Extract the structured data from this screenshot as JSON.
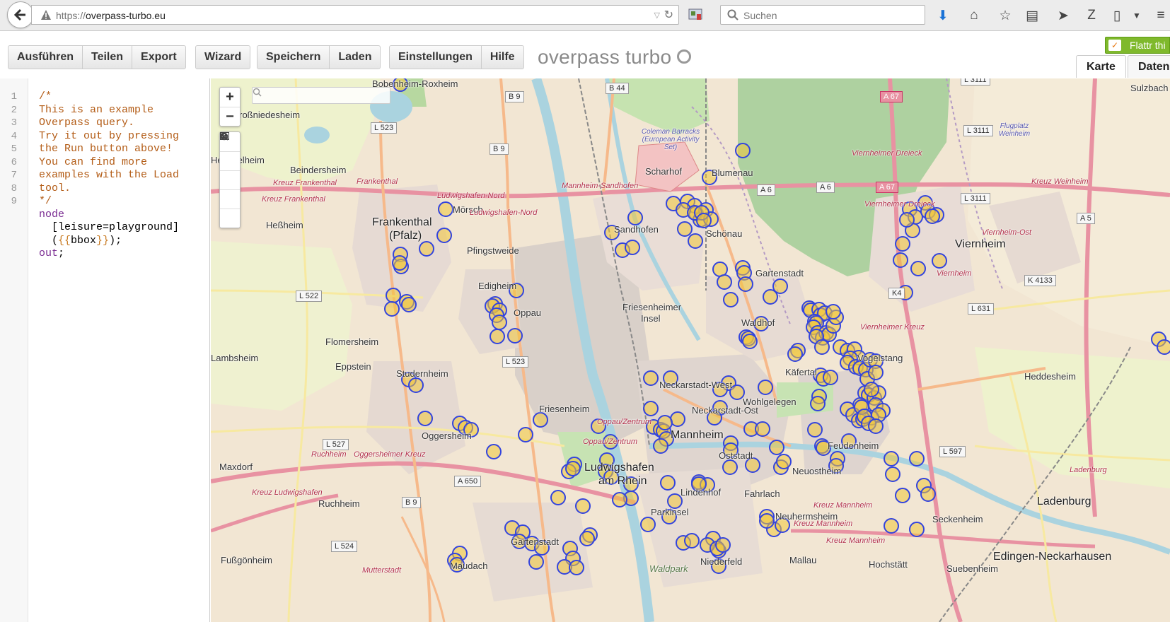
{
  "browser": {
    "url_prefix": "https://",
    "url_host": "overpass-turbo.eu",
    "search_placeholder": "Suchen"
  },
  "toolbar": {
    "buttons_group1": [
      "Ausführen",
      "Teilen",
      "Export"
    ],
    "buttons_group2": [
      "Wizard"
    ],
    "buttons_group3": [
      "Speichern",
      "Laden"
    ],
    "buttons_group4": [
      "Einstellungen",
      "Hilfe"
    ],
    "title": "overpass turbo",
    "flattr_label": "Flattr thi",
    "tab_map": "Karte",
    "tab_data": "Daten"
  },
  "editor": {
    "lines": [
      {
        "n": "1",
        "text": "/*"
      },
      {
        "n": "2",
        "text": "This is an example"
      },
      {
        "n": "3",
        "text": "Overpass query."
      },
      {
        "n": "4",
        "text": "Try it out by pressing"
      },
      {
        "n": "5",
        "text": "the Run button above!"
      },
      {
        "n": "6",
        "text": "You can find more"
      },
      {
        "n": "7",
        "text": "examples with the Load"
      },
      {
        "n": "8",
        "text": "tool."
      },
      {
        "n": "9",
        "text": "*/"
      },
      {
        "n": "",
        "text": "node"
      },
      {
        "n": "",
        "text": "  [leisure=playground]"
      },
      {
        "n": "",
        "text": "  ({{bbox}});"
      },
      {
        "n": "",
        "text": "out;"
      }
    ]
  },
  "map": {
    "controls": {
      "zoom_in": "+",
      "zoom_out": "−"
    },
    "labels": {
      "bobenheim": "Bobenheim-Roxheim",
      "grossniedesheim": "Großniedesheim",
      "heuchelheim": "Heuchelheim",
      "beindersheim": "Beindersheim",
      "hessheim": "Heßheim",
      "frankenthal": "Frankenthal",
      "pfalz": "(Pfalz)",
      "morsch": "Mörsch",
      "pfingstweide": "Pfingstweide",
      "edigheim": "Edigheim",
      "oppau": "Oppau",
      "flomersheim": "Flomersheim",
      "eppstein": "Eppstein",
      "lambsheim": "Lambsheim",
      "studernheim": "Studernheim",
      "oggersheim": "Oggersheim",
      "maxdorf": "Maxdorf",
      "ruchheim": "Ruchheim",
      "fussgonheim": "Fußgönheim",
      "maudach": "Maudach",
      "gartenstadt_lu": "Gartenstadt",
      "friesenheim": "Friesenheim",
      "ludwigshafen": "Ludwigshafen",
      "am_rhein": "am Rhein",
      "friesenheimer_insel": "Friesenheimer",
      "insel": "Insel",
      "scharhof": "Scharhof",
      "blumenau": "Blumenau",
      "sandhofen": "Sandhofen",
      "schonau": "Schönau",
      "gartenstadt_ma": "Gartenstadt",
      "waldhof": "Waldhof",
      "kafertal": "Käfertal",
      "neckarstadt_west": "Neckarstadt-West",
      "neckarstadt_ost": "Neckarstadt-Ost",
      "wohlgelegen": "Wohlgelegen",
      "mannheim": "Mannheim",
      "oststadt": "Oststadt",
      "lindenhof": "Lindenhof",
      "fahrlach": "Fahrlach",
      "neuostheim": "Neuostheim",
      "neuhermsheim": "Neuhermsheim",
      "parkinsel": "Parkinsel",
      "niederfeld": "Niederfeld",
      "waldpark": "Waldpark",
      "mallau": "Mallau",
      "hochstatt": "Hochstätt",
      "feudenheim": "Feudenheim",
      "vogelstang": "Vogelstang",
      "viernheim": "Viernheim",
      "heddesheim": "Heddesheim",
      "ladenburg": "Ladenburg",
      "seckenheim": "Seckenheim",
      "suebenheim": "Suebenheim",
      "edingen": "Edingen-Neckarhausen",
      "sulzbach": "Sulzbach",
      "coleman": "Coleman Barracks (European Activity Set)",
      "flugplatz": "Flugplatz Weinheim",
      "oppau_zentrum": "Oppau/Zentrum",
      "oppau_zentrum2": "Oppau/Zentrum"
    },
    "roads": {
      "b9a": "B 9",
      "b9b": "B 9",
      "b9c": "B 9",
      "b44": "B 44",
      "l523a": "L 523",
      "l523b": "L 523",
      "l522": "L 522",
      "l527": "L 527",
      "l524": "L 524",
      "a67a": "A 67",
      "a67b": "A 67",
      "a6a": "A 6",
      "a6b": "A 6",
      "a650": "A 650",
      "a5": "A 5",
      "l3111a": "L 3111",
      "l3111b": "L 3111",
      "l3111c": "L 3111",
      "l631": "L 631",
      "l597": "L 597",
      "k4133": "K 4133",
      "k4": "K4"
    },
    "road_names": {
      "kreuz_frankenthal1": "Kreuz Frankenthal",
      "kreuz_frankenthal2": "Kreuz Frankenthal",
      "frankenthal22": "Frankenthal",
      "lu_nord1": "Ludwigshafen-Nord",
      "lu_nord2": "Ludwigshafen-Nord",
      "ma_sandhofen": "Mannheim-Sandhofen",
      "viernheimer_dreieck1": "Viernheimer Dreieck",
      "viernheimer_dreieck2": "Viernheimer Dreieck",
      "viernheimer_kreuz": "Viernheimer Kreuz",
      "viernheim_ost": "Viernheim-Ost",
      "kreuz_weinheim": "Kreuz Weinheim",
      "ruchheim_road": "Ruchheim",
      "oggersheimer_kreuz": "Oggersheimer Kreuz",
      "kreuz_ludwigshafen": "Kreuz Ludwigshafen",
      "kreuz_mannheim1": "Kreuz Mannheim",
      "kreuz_mannheim2": "Kreuz Mannheim",
      "kreuz_mannheim3": "Kreuz Mannheim",
      "mutterstadt": "Mutterstadt",
      "ladenburg_road": "Ladenburg",
      "viernheim_small": "Viernheim"
    }
  },
  "colors": {
    "marker_fill": "#f0c63a",
    "marker_stroke": "#3344dd",
    "comment": "#b35c16",
    "keyword": "#7a2c92",
    "map_bg": "#f2e8d6"
  }
}
